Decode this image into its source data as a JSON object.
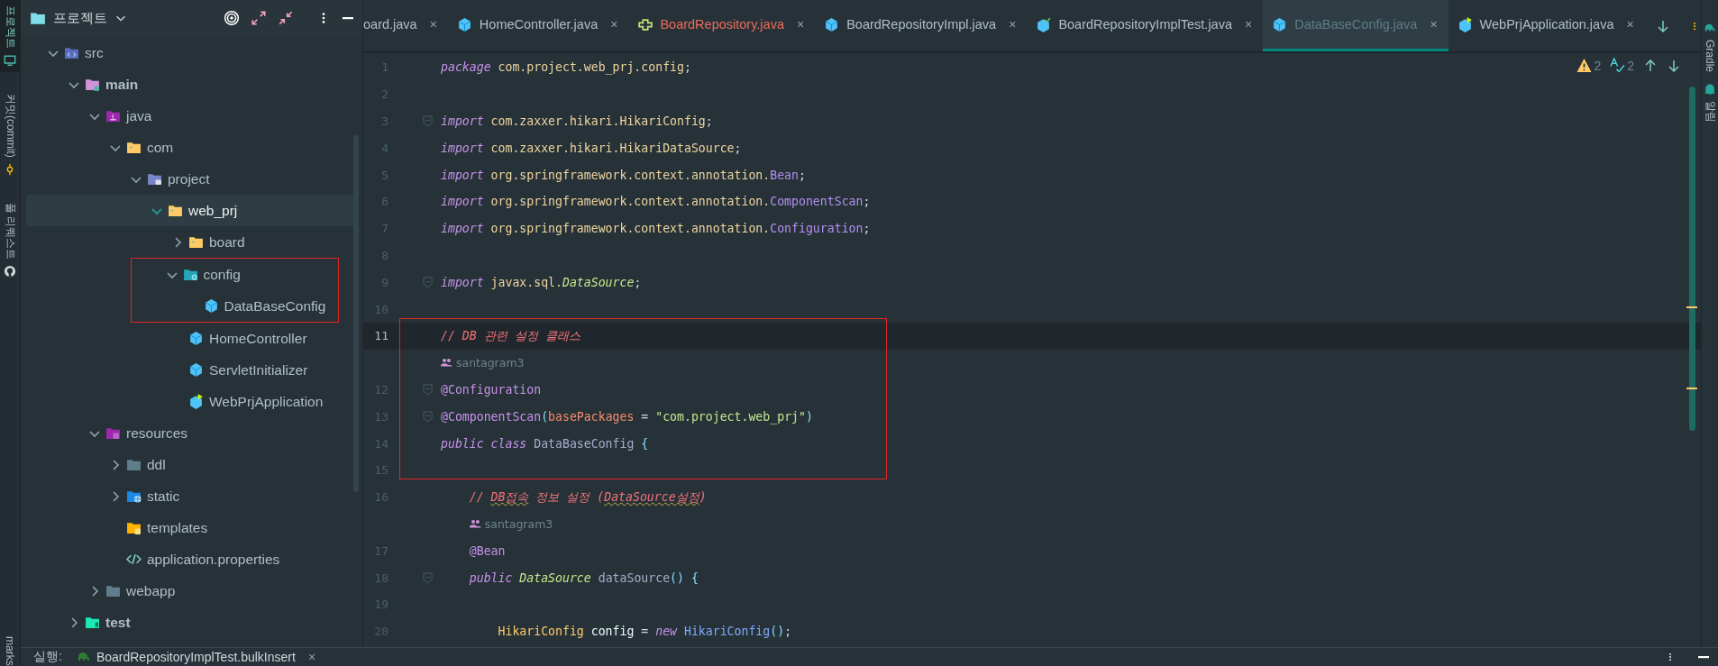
{
  "left_toolbar": [
    {
      "label": "프로젝트",
      "kind": "monitor",
      "selected": true
    },
    {
      "label": "커밋(commit)",
      "kind": "commit",
      "selected": false
    },
    {
      "label": "풀 리퀘스트",
      "kind": "github",
      "selected": false
    },
    {
      "label": "marks",
      "selected": false
    }
  ],
  "project_panel": {
    "title": "프로젝트",
    "tree": [
      {
        "name": "src",
        "kind": "source-folder",
        "expanded": true,
        "bold": false,
        "selected": false,
        "children": [
          {
            "name": "main",
            "kind": "module-folder",
            "expanded": true,
            "bold": true,
            "selected": false,
            "children": [
              {
                "name": "java",
                "kind": "java-folder",
                "expanded": true,
                "bold": false,
                "selected": false,
                "children": [
                  {
                    "name": "com",
                    "kind": "package",
                    "expanded": true,
                    "bold": false,
                    "selected": false,
                    "children": [
                      {
                        "name": "project",
                        "kind": "project-package",
                        "expanded": true,
                        "bold": false,
                        "selected": false,
                        "children": [
                          {
                            "name": "web_prj",
                            "kind": "package",
                            "expanded": true,
                            "bold": false,
                            "selected": true,
                            "children": [
                              {
                                "name": "board",
                                "kind": "package",
                                "expanded": false,
                                "bold": false,
                                "selected": false
                              },
                              {
                                "name": "config",
                                "kind": "config-folder",
                                "expanded": true,
                                "bold": false,
                                "selected": false,
                                "highlighted": true,
                                "children": [
                                  {
                                    "name": "DataBaseConfig",
                                    "kind": "class",
                                    "bold": false,
                                    "selected": false
                                  }
                                ]
                              },
                              {
                                "name": "HomeController",
                                "kind": "class",
                                "bold": false,
                                "selected": false
                              },
                              {
                                "name": "ServletInitializer",
                                "kind": "class",
                                "bold": false,
                                "selected": false
                              },
                              {
                                "name": "WebPrjApplication",
                                "kind": "app-class",
                                "bold": false,
                                "selected": false
                              }
                            ]
                          }
                        ]
                      }
                    ]
                  }
                ]
              },
              {
                "name": "resources",
                "kind": "resources-folder",
                "expanded": true,
                "bold": false,
                "selected": false,
                "children": [
                  {
                    "name": "ddl",
                    "kind": "plain-folder",
                    "expanded": false,
                    "bold": false,
                    "selected": false
                  },
                  {
                    "name": "static",
                    "kind": "web-folder",
                    "expanded": false,
                    "bold": false,
                    "selected": false
                  },
                  {
                    "name": "templates",
                    "kind": "template-folder",
                    "bold": false,
                    "selected": false
                  },
                  {
                    "name": "application.properties",
                    "kind": "properties",
                    "bold": false,
                    "selected": false
                  }
                ]
              },
              {
                "name": "webapp",
                "kind": "plain-folder",
                "expanded": false,
                "bold": false,
                "selected": false
              }
            ]
          },
          {
            "name": "test",
            "kind": "test-folder",
            "expanded": false,
            "bold": true,
            "selected": false
          }
        ]
      }
    ]
  },
  "tabs": [
    {
      "label": "oard.java",
      "close": "×",
      "selected": false,
      "error": false
    },
    {
      "label": "HomeController.java",
      "kind": "class",
      "close": "×",
      "selected": false,
      "error": false
    },
    {
      "label": "BoardRepository.java",
      "kind": "interface",
      "close": "×",
      "selected": false,
      "error": true
    },
    {
      "label": "BoardRepositoryImpl.java",
      "kind": "class",
      "close": "×",
      "selected": false,
      "error": false
    },
    {
      "label": "BoardRepositoryImplTest.java",
      "kind": "test-class",
      "close": "×",
      "selected": false,
      "error": false
    },
    {
      "label": "DataBaseConfig.java",
      "kind": "class",
      "close": "×",
      "selected": true,
      "error": false
    },
    {
      "label": "WebPrjApplication.java",
      "kind": "app-class",
      "close": "×",
      "selected": false,
      "error": false
    }
  ],
  "editor": {
    "warnings": "2",
    "typos": "2",
    "lines": [
      {
        "kind": "code",
        "number": "1",
        "current": false,
        "tokens": [
          {
            "text": "package",
            "kind": "kw"
          },
          {
            "text": " com.project.web_prj.config",
            "kind": "pkg"
          },
          {
            "text": ";",
            "kind": "punct"
          }
        ]
      },
      {
        "kind": "code",
        "number": "2",
        "current": false
      },
      {
        "kind": "code",
        "number": "3",
        "fold": true,
        "current": false,
        "tokens": [
          {
            "text": "import",
            "kind": "kw"
          },
          {
            "text": " com.zaxxer.hikari.HikariConfig",
            "kind": "pkg"
          },
          {
            "text": ";",
            "kind": "punct"
          }
        ]
      },
      {
        "kind": "code",
        "number": "4",
        "current": false,
        "tokens": [
          {
            "text": "import",
            "kind": "kw"
          },
          {
            "text": " com.zaxxer.hikari.HikariDataSource",
            "kind": "pkg"
          },
          {
            "text": ";",
            "kind": "punct"
          }
        ]
      },
      {
        "kind": "code",
        "number": "5",
        "current": false,
        "tokens": [
          {
            "text": "import",
            "kind": "kw"
          },
          {
            "text": " org.springframework.context.annotation.",
            "kind": "pkg"
          },
          {
            "text": "Bean",
            "kind": "cls"
          },
          {
            "text": ";",
            "kind": "punct"
          }
        ]
      },
      {
        "kind": "code",
        "number": "6",
        "current": false,
        "tokens": [
          {
            "text": "import",
            "kind": "kw"
          },
          {
            "text": " org.springframework.context.annotation.",
            "kind": "pkg"
          },
          {
            "text": "ComponentScan",
            "kind": "cls"
          },
          {
            "text": ";",
            "kind": "punct"
          }
        ]
      },
      {
        "kind": "code",
        "number": "7",
        "current": false,
        "tokens": [
          {
            "text": "import",
            "kind": "kw"
          },
          {
            "text": " org.springframework.context.annotation.",
            "kind": "pkg"
          },
          {
            "text": "Configuration",
            "kind": "cls"
          },
          {
            "text": ";",
            "kind": "punct"
          }
        ]
      },
      {
        "kind": "code",
        "number": "8",
        "current": false
      },
      {
        "kind": "code",
        "number": "9",
        "fold": true,
        "current": false,
        "tokens": [
          {
            "text": "import",
            "kind": "kw"
          },
          {
            "text": " javax.sql.",
            "kind": "pkg"
          },
          {
            "text": "DataSource",
            "kind": "ctype"
          },
          {
            "text": ";",
            "kind": "punct"
          }
        ]
      },
      {
        "kind": "code",
        "number": "10",
        "current": false
      },
      {
        "kind": "code",
        "number": "11",
        "current": true,
        "tokens": [
          {
            "text": "// DB 관련 설정 클래스",
            "kind": "comment"
          }
        ]
      },
      {
        "kind": "author",
        "text": "santagram3"
      },
      {
        "kind": "code",
        "number": "12",
        "fold": true,
        "current": false,
        "tokens": [
          {
            "text": "@Configuration",
            "kind": "ann"
          }
        ]
      },
      {
        "kind": "code",
        "number": "13",
        "fold": true,
        "current": false,
        "tokens": [
          {
            "text": "@ComponentScan",
            "kind": "ann"
          },
          {
            "text": "(",
            "kind": "brace"
          },
          {
            "text": "basePackages",
            "kind": "param"
          },
          {
            "text": " = ",
            "kind": "punct"
          },
          {
            "text": "\"com.project.web_prj\"",
            "kind": "str"
          },
          {
            "text": ")",
            "kind": "brace"
          }
        ]
      },
      {
        "kind": "code",
        "number": "14",
        "current": false,
        "tokens": [
          {
            "text": "public class",
            "kind": "kw"
          },
          {
            "text": " DataBaseConfig ",
            "kind": "plain"
          },
          {
            "text": "{",
            "kind": "brace"
          }
        ]
      },
      {
        "kind": "code",
        "number": "15",
        "current": false
      },
      {
        "kind": "code",
        "number": "16",
        "current": false,
        "tokens": [
          {
            "text": "    // ",
            "kind": "comment",
            "typo": false
          },
          {
            "text": "DB접속",
            "kind": "comment",
            "typo": true
          },
          {
            "text": " 정보 설정 (",
            "kind": "comment",
            "typo": false
          },
          {
            "text": "DataSource설정",
            "kind": "comment",
            "typo": true
          },
          {
            "text": ")",
            "kind": "comment",
            "typo": false
          }
        ]
      },
      {
        "kind": "author",
        "text": "santagram3"
      },
      {
        "kind": "code",
        "number": "17",
        "current": false,
        "tokens": [
          {
            "text": "    @Bean",
            "kind": "ann"
          }
        ]
      },
      {
        "kind": "code",
        "number": "18",
        "fold": true,
        "current": false,
        "tokens": [
          {
            "text": "    public",
            "kind": "kw"
          },
          {
            "text": " DataSource",
            "kind": "ctype"
          },
          {
            "text": " dataSource",
            "kind": "plain"
          },
          {
            "text": "()",
            "kind": "brace"
          },
          {
            "text": " {",
            "kind": "brace"
          }
        ]
      },
      {
        "kind": "code",
        "number": "19",
        "current": false
      },
      {
        "kind": "code",
        "number": "20",
        "current": false,
        "tokens": [
          {
            "text": "        HikariConfig",
            "kind": "type"
          },
          {
            "text": " config",
            "kind": "var"
          },
          {
            "text": " = ",
            "kind": "punct"
          },
          {
            "text": "new",
            "kind": "kw"
          },
          {
            "text": " HikariConfig",
            "kind": "fn"
          },
          {
            "text": "()",
            "kind": "brace"
          },
          {
            "text": ";",
            "kind": "punct"
          }
        ]
      }
    ]
  },
  "right_toolbar": [
    {
      "label": "Gradle",
      "kind": "elephant"
    },
    {
      "label": "알림",
      "kind": "bell"
    }
  ],
  "run_bar": {
    "label": "실행:",
    "tab": "BoardRepositoryImplTest.bulkInsert",
    "close": "×"
  }
}
